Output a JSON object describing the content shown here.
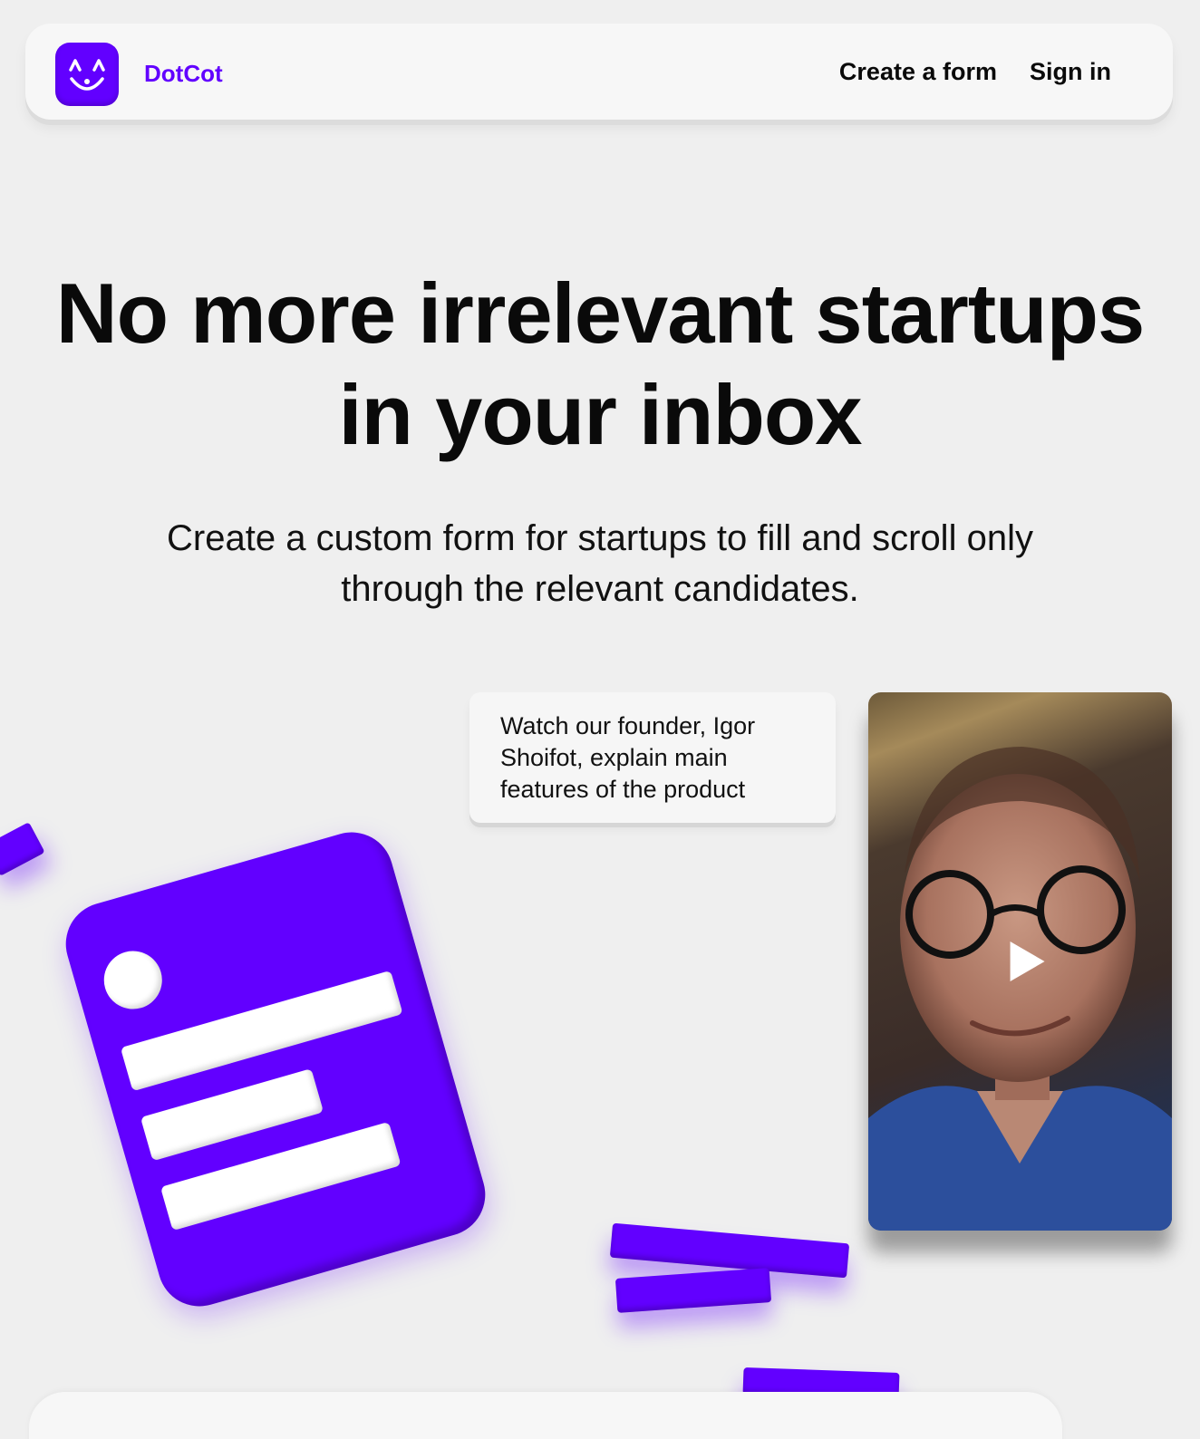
{
  "brand": {
    "name": "DotCot",
    "accent_color": "#6200ff",
    "logo_icon": "smiling-cat-face-icon"
  },
  "nav": {
    "create_form": "Create a form",
    "sign_in": "Sign in"
  },
  "hero": {
    "headline": "No more irrelevant startups in your inbox",
    "subtitle": "Create a custom form for startups to fill and scroll only through the relevant candidates."
  },
  "founder_note": "Watch our founder, Igor Shoifot, explain main features of the product",
  "video": {
    "play_icon": "play-icon"
  }
}
